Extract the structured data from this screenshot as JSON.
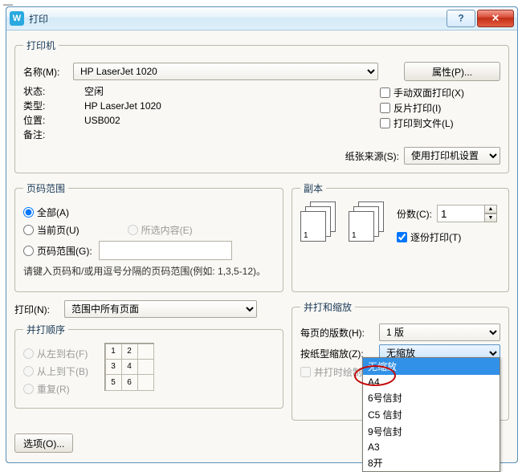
{
  "window": {
    "title": "打印",
    "icon_letter": "W",
    "help_tooltip": "帮助",
    "close_tooltip": "关闭"
  },
  "printer": {
    "legend": "打印机",
    "name_label": "名称(M):",
    "name_value": "HP LaserJet 1020",
    "props_button": "属性(P)...",
    "status_label": "状态:",
    "status_value": "空闲",
    "type_label": "类型:",
    "type_value": "HP LaserJet 1020",
    "where_label": "位置:",
    "where_value": "USB002",
    "comment_label": "备注:",
    "comment_value": "",
    "manual_duplex": "手动双面打印(X)",
    "reverse_print": "反片打印(I)",
    "print_to_file": "打印到文件(L)",
    "paper_source_label": "纸张来源(S):",
    "paper_source_value": "使用打印机设置"
  },
  "page_range": {
    "legend": "页码范围",
    "all": "全部(A)",
    "current": "当前页(U)",
    "selection": "所选内容(E)",
    "pages": "页码范围(G):",
    "hint": "请键入页码和/或用逗号分隔的页码范围(例如: 1,3,5-12)。"
  },
  "print_what": {
    "label": "打印(N):",
    "value": "范围中所有页面"
  },
  "merge_order": {
    "legend": "并打顺序",
    "ltr": "从左到右(F)",
    "ttb": "从上到下(B)",
    "repeat": "重复(R)"
  },
  "copies": {
    "legend": "副本",
    "count_label": "份数(C):",
    "count_value": "1",
    "collate": "逐份打印(T)"
  },
  "scaling": {
    "legend": "并打和缩放",
    "per_sheet_label": "每页的版数(H):",
    "per_sheet_value": "1 版",
    "by_paper_label": "按纸型缩放(Z):",
    "by_paper_value": "无缩放",
    "draw_border": "并打时绘制分隔线(D)",
    "dropdown_options": [
      "无缩放",
      "A4",
      "6号信封",
      "C5 信封",
      "9号信封",
      "A3",
      "8开"
    ],
    "dropdown_selected_index": 0
  },
  "options_button": "选项(O)...",
  "background_fragment": "—"
}
